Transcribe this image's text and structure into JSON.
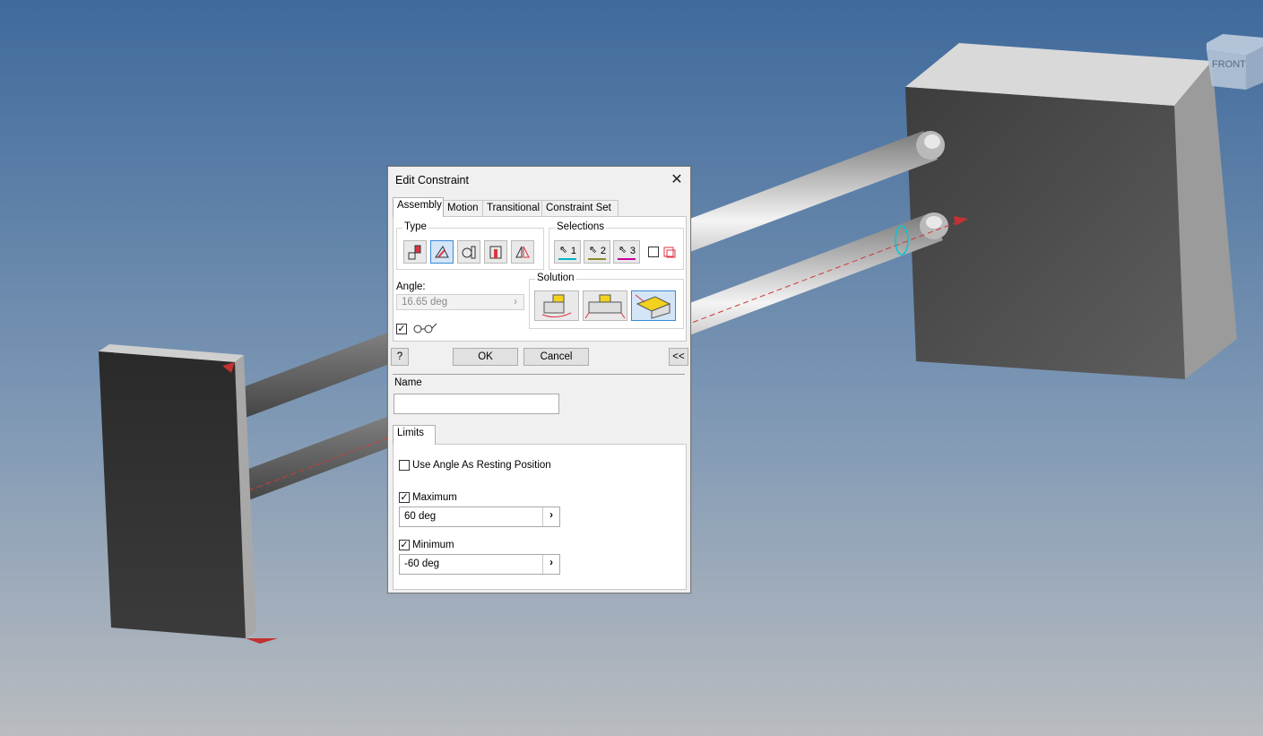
{
  "viewcube": {
    "label": "FRONT"
  },
  "dialog": {
    "title": "Edit Constraint",
    "tabs": [
      "Assembly",
      "Motion",
      "Transitional",
      "Constraint Set"
    ],
    "type_group": {
      "label": "Type",
      "selected_index": 1,
      "icons": [
        "mate-constraint-icon",
        "angle-constraint-icon",
        "tangent-constraint-icon",
        "insert-constraint-icon",
        "symmetry-constraint-icon"
      ]
    },
    "selections_group": {
      "label": "Selections",
      "buttons": [
        "1",
        "2",
        "3"
      ],
      "colors": [
        "#00b5c8",
        "#8a8a2a",
        "#c800a0"
      ],
      "pick_part_first": false
    },
    "angle": {
      "label": "Angle:",
      "value": "16.65 deg"
    },
    "show_preview_checked": true,
    "solution": {
      "label": "Solution",
      "selected_index": 2
    },
    "buttons": {
      "ok": "OK",
      "cancel": "Cancel",
      "collapse": "<<"
    },
    "name": {
      "label": "Name",
      "value": ""
    },
    "limits": {
      "tab": "Limits",
      "resting": {
        "label": "Use Angle As Resting Position",
        "checked": false
      },
      "maximum": {
        "label": "Maximum",
        "checked": true,
        "value": "60 deg"
      },
      "minimum": {
        "label": "Minimum",
        "checked": true,
        "value": "-60 deg"
      }
    }
  }
}
